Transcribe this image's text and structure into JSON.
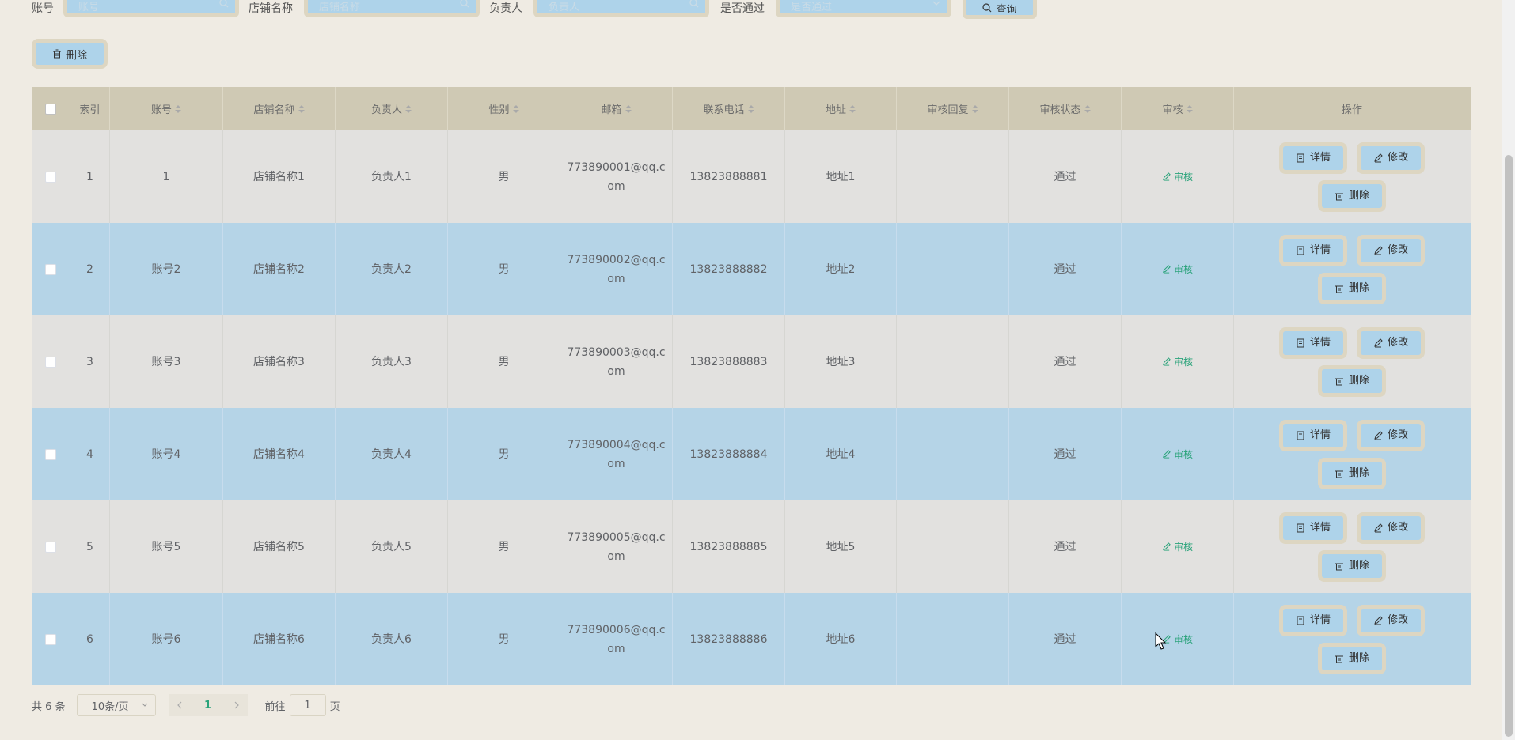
{
  "search": {
    "account_label": "账号",
    "account_placeholder": "账号",
    "shop_label": "店铺名称",
    "shop_placeholder": "店铺名称",
    "manager_label": "负责人",
    "manager_placeholder": "负责人",
    "passed_label": "是否通过",
    "passed_placeholder": "是否通过",
    "query_label": "查询"
  },
  "toolbar": {
    "delete_label": "删除"
  },
  "table": {
    "headers": {
      "index": "索引",
      "account": "账号",
      "shop_name": "店铺名称",
      "manager": "负责人",
      "gender": "性别",
      "email": "邮箱",
      "phone": "联系电话",
      "address": "地址",
      "audit_reply": "审核回复",
      "audit_status": "审核状态",
      "audit": "审核",
      "actions": "操作"
    },
    "rows": [
      {
        "index": "1",
        "account": "1",
        "shop_name": "店铺名称1",
        "manager": "负责人1",
        "gender": "男",
        "email_line1": "773890001@qq.c",
        "email_line2": "om",
        "phone": "13823888881",
        "address": "地址1",
        "audit_reply": "",
        "audit_status": "通过",
        "audit_link": "审核"
      },
      {
        "index": "2",
        "account": "账号2",
        "shop_name": "店铺名称2",
        "manager": "负责人2",
        "gender": "男",
        "email_line1": "773890002@qq.c",
        "email_line2": "om",
        "phone": "13823888882",
        "address": "地址2",
        "audit_reply": "",
        "audit_status": "通过",
        "audit_link": "审核"
      },
      {
        "index": "3",
        "account": "账号3",
        "shop_name": "店铺名称3",
        "manager": "负责人3",
        "gender": "男",
        "email_line1": "773890003@qq.c",
        "email_line2": "om",
        "phone": "13823888883",
        "address": "地址3",
        "audit_reply": "",
        "audit_status": "通过",
        "audit_link": "审核"
      },
      {
        "index": "4",
        "account": "账号4",
        "shop_name": "店铺名称4",
        "manager": "负责人4",
        "gender": "男",
        "email_line1": "773890004@qq.c",
        "email_line2": "om",
        "phone": "13823888884",
        "address": "地址4",
        "audit_reply": "",
        "audit_status": "通过",
        "audit_link": "审核"
      },
      {
        "index": "5",
        "account": "账号5",
        "shop_name": "店铺名称5",
        "manager": "负责人5",
        "gender": "男",
        "email_line1": "773890005@qq.c",
        "email_line2": "om",
        "phone": "13823888885",
        "address": "地址5",
        "audit_reply": "",
        "audit_status": "通过",
        "audit_link": "审核"
      },
      {
        "index": "6",
        "account": "账号6",
        "shop_name": "店铺名称6",
        "manager": "负责人6",
        "gender": "男",
        "email_line1": "773890006@qq.c",
        "email_line2": "om",
        "phone": "13823888886",
        "address": "地址6",
        "audit_reply": "",
        "audit_status": "通过",
        "audit_link": "审核"
      }
    ],
    "action_labels": {
      "detail": "详情",
      "edit": "修改",
      "delete": "删除"
    }
  },
  "pagination": {
    "total": "共 6 条",
    "page_size": "10条/页",
    "current_page": "1",
    "goto_prefix": "前往",
    "goto_value": "1",
    "goto_suffix": "页"
  },
  "colors": {
    "background": "#efebe3",
    "header_bg": "#cfc9b4",
    "row_odd": "#e2e1df",
    "row_even": "#b5d4e7",
    "button_bg": "#aed3ea",
    "button_border": "#ddd6c2",
    "accent_green": "#2aa37a"
  },
  "icons": {
    "search": "search-icon",
    "chevron": "chevron-down-icon",
    "delete": "trash-icon",
    "detail": "document-icon",
    "edit": "pencil-icon",
    "audit": "pencil-icon"
  }
}
